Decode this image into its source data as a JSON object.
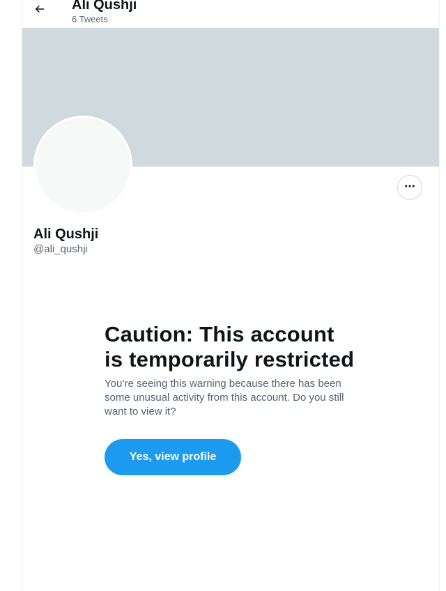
{
  "header": {
    "back_icon": "arrow-left-icon",
    "title": "Ali Qushji",
    "subtitle": "6 Tweets"
  },
  "profile": {
    "name": "Ali Qushji",
    "handle": "@ali_qushji",
    "more_icon": "more-horizontal-icon",
    "banner_color": "#cfd9de",
    "avatar_color": "#f7f9f9"
  },
  "warning": {
    "title": "Caution: This account is temporarily restricted",
    "body": "You’re seeing this warning because there has been some unusual activity from this account. Do you still want to view it?",
    "button_label": "Yes, view profile",
    "button_color": "#1d9bf0"
  }
}
